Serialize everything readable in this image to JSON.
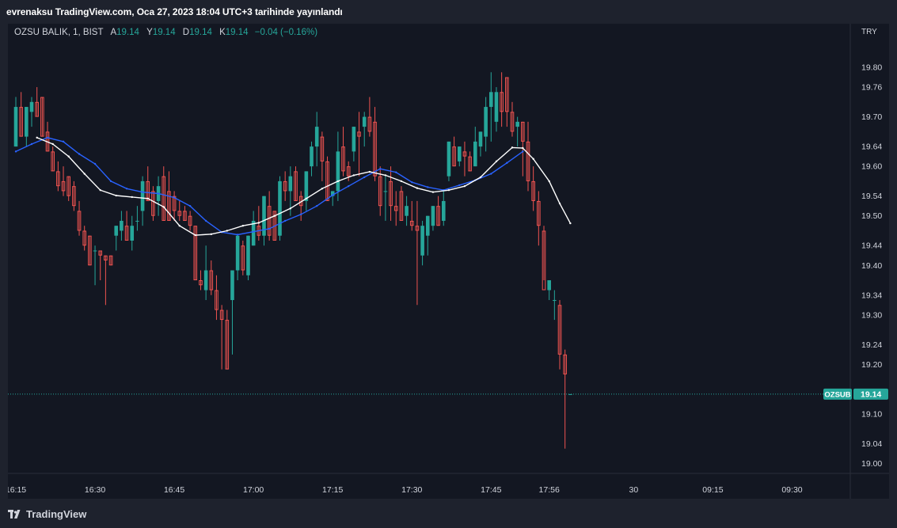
{
  "header": {
    "publish_text": "evrenaksu TradingView.com, Oca 27, 2023 18:04 UTC+3 tarihinde yayınlandı"
  },
  "legend": {
    "symbol": "OZSU BALIK, 1, BIST",
    "open_label": "A",
    "open_value": "19.14",
    "high_label": "Y",
    "high_value": "19.14",
    "low_label": "D",
    "low_value": "19.14",
    "close_label": "K",
    "close_value": "19.14",
    "change": "−0.04 (−0.16%)"
  },
  "footer": {
    "brand": "TradingView"
  },
  "colors": {
    "up": "#26a69a",
    "down": "#ef5350",
    "ma_blue": "#2962ff",
    "ma_white": "#ffffff",
    "background": "#131722",
    "text": "#d1d4dc"
  },
  "chart_data": {
    "type": "candlestick",
    "currency": "TRY",
    "ylim": [
      18.98,
      19.84
    ],
    "y_ticks": [
      "19.80",
      "19.76",
      "19.70",
      "19.64",
      "19.60",
      "19.54",
      "19.50",
      "19.44",
      "19.40",
      "19.34",
      "19.30",
      "19.24",
      "19.20",
      "19.14",
      "19.10",
      "19.04",
      "19.00"
    ],
    "x_ticks": [
      {
        "label": "16:15",
        "i": 0
      },
      {
        "label": "16:30",
        "i": 15
      },
      {
        "label": "16:45",
        "i": 30
      },
      {
        "label": "17:00",
        "i": 45
      },
      {
        "label": "17:15",
        "i": 60
      },
      {
        "label": "17:30",
        "i": 75
      },
      {
        "label": "17:45",
        "i": 90
      },
      {
        "label": "17:56",
        "i": 101
      },
      {
        "label": "30",
        "i": 117
      },
      {
        "label": "09:15",
        "i": 132
      },
      {
        "label": "09:30",
        "i": 147
      }
    ],
    "price_label": {
      "symbol": "OZSUB",
      "value": "19.14"
    },
    "last_price": 19.14,
    "candles": [
      [
        19.64,
        19.74,
        19.64,
        19.72
      ],
      [
        19.72,
        19.75,
        19.66,
        19.66
      ],
      [
        19.66,
        19.72,
        19.64,
        19.72
      ],
      [
        19.71,
        19.74,
        19.68,
        19.73
      ],
      [
        19.73,
        19.76,
        19.7,
        19.7
      ],
      [
        19.74,
        19.74,
        19.66,
        19.66
      ],
      [
        19.67,
        19.69,
        19.63,
        19.63
      ],
      [
        19.63,
        19.64,
        19.59,
        19.59
      ],
      [
        19.59,
        19.61,
        19.55,
        19.56
      ],
      [
        19.57,
        19.6,
        19.54,
        19.55
      ],
      [
        19.58,
        19.58,
        19.53,
        19.54
      ],
      [
        19.56,
        19.57,
        19.51,
        19.52
      ],
      [
        19.51,
        19.53,
        19.46,
        19.47
      ],
      [
        19.47,
        19.48,
        19.43,
        19.44
      ],
      [
        19.46,
        19.46,
        19.4,
        19.4
      ],
      [
        19.43,
        19.44,
        19.36,
        19.43
      ],
      [
        19.43,
        19.43,
        19.37,
        19.42
      ],
      [
        19.42,
        19.42,
        19.32,
        19.41
      ],
      [
        19.42,
        19.42,
        19.4,
        19.4
      ],
      [
        19.46,
        19.48,
        19.43,
        19.48
      ],
      [
        19.47,
        19.51,
        19.45,
        19.49
      ],
      [
        19.48,
        19.51,
        19.45,
        19.45
      ],
      [
        19.45,
        19.5,
        19.43,
        19.48
      ],
      [
        19.49,
        19.52,
        19.47,
        19.49
      ],
      [
        19.51,
        19.58,
        19.48,
        19.57
      ],
      [
        19.57,
        19.6,
        19.53,
        19.53
      ],
      [
        19.55,
        19.56,
        19.49,
        19.5
      ],
      [
        19.53,
        19.58,
        19.5,
        19.56
      ],
      [
        19.58,
        19.6,
        19.49,
        19.49
      ],
      [
        19.55,
        19.59,
        19.49,
        19.49
      ],
      [
        19.54,
        19.55,
        19.49,
        19.51
      ],
      [
        19.51,
        19.53,
        19.49,
        19.5
      ],
      [
        19.51,
        19.52,
        19.49,
        19.49
      ],
      [
        19.5,
        19.51,
        19.47,
        19.48
      ],
      [
        19.48,
        19.48,
        19.37,
        19.37
      ],
      [
        19.37,
        19.39,
        19.35,
        19.36
      ],
      [
        19.35,
        19.44,
        19.33,
        19.39
      ],
      [
        19.39,
        19.41,
        19.34,
        19.35
      ],
      [
        19.35,
        19.38,
        19.29,
        19.31
      ],
      [
        19.31,
        19.32,
        19.19,
        19.29
      ],
      [
        19.29,
        19.31,
        19.19,
        19.19
      ],
      [
        19.33,
        19.39,
        19.22,
        19.39
      ],
      [
        19.39,
        19.46,
        19.37,
        19.46
      ],
      [
        19.44,
        19.45,
        19.38,
        19.39
      ],
      [
        19.38,
        19.46,
        19.37,
        19.46
      ],
      [
        19.44,
        19.51,
        19.44,
        19.49
      ],
      [
        19.48,
        19.52,
        19.45,
        19.46
      ],
      [
        19.46,
        19.54,
        19.44,
        19.54
      ],
      [
        19.52,
        19.55,
        19.45,
        19.46
      ],
      [
        19.51,
        19.51,
        19.45,
        19.45
      ],
      [
        19.46,
        19.58,
        19.45,
        19.57
      ],
      [
        19.57,
        19.59,
        19.53,
        19.55
      ],
      [
        19.55,
        19.6,
        19.5,
        19.58
      ],
      [
        19.59,
        19.6,
        19.53,
        19.53
      ],
      [
        19.54,
        19.55,
        19.49,
        19.52
      ],
      [
        19.53,
        19.59,
        19.51,
        19.59
      ],
      [
        19.6,
        19.65,
        19.58,
        19.64
      ],
      [
        19.64,
        19.71,
        19.6,
        19.68
      ],
      [
        19.66,
        19.67,
        19.57,
        19.61
      ],
      [
        19.61,
        19.62,
        19.53,
        19.53
      ],
      [
        19.54,
        19.55,
        19.52,
        19.55
      ],
      [
        19.55,
        19.67,
        19.53,
        19.63
      ],
      [
        19.64,
        19.68,
        19.58,
        19.59
      ],
      [
        19.6,
        19.61,
        19.57,
        19.58
      ],
      [
        19.63,
        19.68,
        19.61,
        19.68
      ],
      [
        19.67,
        19.71,
        19.58,
        19.66
      ],
      [
        19.68,
        19.71,
        19.64,
        19.7
      ],
      [
        19.7,
        19.74,
        19.66,
        19.67
      ],
      [
        19.69,
        19.72,
        19.57,
        19.58
      ],
      [
        19.58,
        19.6,
        19.5,
        19.52
      ],
      [
        19.55,
        19.58,
        19.49,
        19.55
      ],
      [
        19.57,
        19.6,
        19.49,
        19.52
      ],
      [
        19.52,
        19.55,
        19.48,
        19.51
      ],
      [
        19.55,
        19.56,
        19.49,
        19.49
      ],
      [
        19.5,
        19.54,
        19.48,
        19.52
      ],
      [
        19.49,
        19.53,
        19.47,
        19.48
      ],
      [
        19.48,
        19.53,
        19.32,
        19.47
      ],
      [
        19.42,
        19.49,
        19.4,
        19.48
      ],
      [
        19.46,
        19.5,
        19.42,
        19.5
      ],
      [
        19.48,
        19.52,
        19.47,
        19.52
      ],
      [
        19.52,
        19.54,
        19.48,
        19.48
      ],
      [
        19.49,
        19.55,
        19.48,
        19.53
      ],
      [
        19.58,
        19.65,
        19.57,
        19.65
      ],
      [
        19.64,
        19.66,
        19.6,
        19.6
      ],
      [
        19.61,
        19.64,
        19.6,
        19.64
      ],
      [
        19.63,
        19.65,
        19.58,
        19.62
      ],
      [
        19.62,
        19.63,
        19.59,
        19.59
      ],
      [
        19.6,
        19.68,
        19.6,
        19.65
      ],
      [
        19.64,
        19.67,
        19.62,
        19.67
      ],
      [
        19.66,
        19.74,
        19.63,
        19.72
      ],
      [
        19.72,
        19.79,
        19.65,
        19.75
      ],
      [
        19.69,
        19.76,
        19.67,
        19.75
      ],
      [
        19.75,
        19.79,
        19.68,
        19.71
      ],
      [
        19.78,
        19.78,
        19.68,
        19.71
      ],
      [
        19.71,
        19.73,
        19.66,
        19.67
      ],
      [
        19.68,
        19.7,
        19.64,
        19.69
      ],
      [
        19.69,
        19.69,
        19.58,
        19.65
      ],
      [
        19.65,
        19.69,
        19.55,
        19.57
      ],
      [
        19.57,
        19.6,
        19.51,
        19.53
      ],
      [
        19.53,
        19.55,
        19.44,
        19.48
      ],
      [
        19.47,
        19.48,
        19.37,
        19.35
      ],
      [
        19.35,
        19.36,
        19.33,
        19.37
      ],
      [
        19.33,
        19.35,
        19.29,
        19.33
      ],
      [
        19.32,
        19.33,
        19.19,
        19.22
      ],
      [
        19.22,
        19.23,
        19.03,
        19.18
      ],
      [
        19.14,
        19.14,
        19.14,
        19.14
      ]
    ],
    "series": [
      {
        "color": "#2962ff",
        "points": [
          [
            0,
            19.63
          ],
          [
            3,
            19.645
          ],
          [
            6,
            19.658
          ],
          [
            9,
            19.65
          ],
          [
            12,
            19.625
          ],
          [
            15,
            19.605
          ],
          [
            18,
            19.57
          ],
          [
            21,
            19.555
          ],
          [
            24,
            19.548
          ],
          [
            27,
            19.545
          ],
          [
            30,
            19.537
          ],
          [
            33,
            19.52
          ],
          [
            36,
            19.49
          ],
          [
            39,
            19.467
          ],
          [
            42,
            19.462
          ],
          [
            45,
            19.468
          ],
          [
            48,
            19.474
          ],
          [
            51,
            19.49
          ],
          [
            54,
            19.503
          ],
          [
            57,
            19.52
          ],
          [
            60,
            19.542
          ],
          [
            63,
            19.56
          ],
          [
            66,
            19.578
          ],
          [
            69,
            19.595
          ],
          [
            72,
            19.588
          ],
          [
            75,
            19.568
          ],
          [
            78,
            19.558
          ],
          [
            81,
            19.552
          ],
          [
            84,
            19.562
          ],
          [
            87,
            19.572
          ],
          [
            90,
            19.585
          ],
          [
            93,
            19.607
          ],
          [
            96,
            19.63
          ]
        ]
      },
      {
        "color": "#ffffff",
        "points": [
          [
            4,
            19.658
          ],
          [
            7,
            19.645
          ],
          [
            10,
            19.62
          ],
          [
            13,
            19.585
          ],
          [
            16,
            19.552
          ],
          [
            19,
            19.541
          ],
          [
            22,
            19.538
          ],
          [
            25,
            19.535
          ],
          [
            28,
            19.518
          ],
          [
            31,
            19.48
          ],
          [
            34,
            19.461
          ],
          [
            37,
            19.463
          ],
          [
            40,
            19.47
          ],
          [
            43,
            19.48
          ],
          [
            46,
            19.486
          ],
          [
            49,
            19.5
          ],
          [
            52,
            19.515
          ],
          [
            55,
            19.535
          ],
          [
            58,
            19.555
          ],
          [
            61,
            19.57
          ],
          [
            64,
            19.582
          ],
          [
            67,
            19.589
          ],
          [
            70,
            19.582
          ],
          [
            73,
            19.57
          ],
          [
            76,
            19.556
          ],
          [
            79,
            19.548
          ],
          [
            82,
            19.552
          ],
          [
            85,
            19.56
          ],
          [
            88,
            19.578
          ],
          [
            91,
            19.61
          ],
          [
            94,
            19.638
          ],
          [
            96,
            19.637
          ],
          [
            98,
            19.615
          ],
          [
            101,
            19.57
          ],
          [
            103,
            19.525
          ],
          [
            105,
            19.485
          ]
        ]
      }
    ]
  }
}
